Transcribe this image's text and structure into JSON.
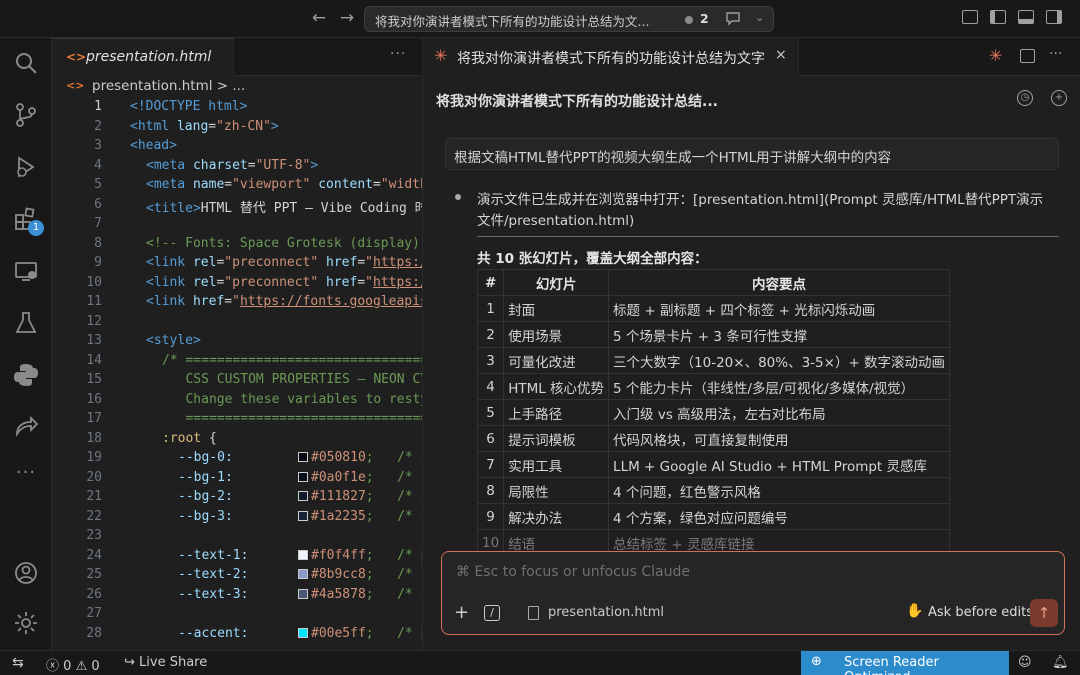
{
  "titlebar": {
    "command_center_title": "将我对你演讲者模式下所有的功能设计总结为文...",
    "notification_count": "2"
  },
  "activity_bar": {
    "extensions_badge": "1"
  },
  "editor": {
    "tab_title": "presentation.html",
    "breadcrumb": "presentation.html > ...",
    "icon_glyph": "<>",
    "more": "···"
  },
  "code_lines": [
    {
      "n": "1"
    },
    {
      "n": "2"
    },
    {
      "n": "3"
    },
    {
      "n": "4"
    },
    {
      "n": "5"
    },
    {
      "n": "6"
    },
    {
      "n": "7"
    },
    {
      "n": "8"
    },
    {
      "n": "9"
    },
    {
      "n": "10"
    },
    {
      "n": "11"
    },
    {
      "n": "12"
    },
    {
      "n": "13"
    },
    {
      "n": "14"
    },
    {
      "n": "15"
    },
    {
      "n": "16"
    },
    {
      "n": "17"
    },
    {
      "n": "18"
    },
    {
      "n": "19"
    },
    {
      "n": "20"
    },
    {
      "n": "21"
    },
    {
      "n": "22"
    },
    {
      "n": "23"
    },
    {
      "n": "24"
    },
    {
      "n": "25"
    },
    {
      "n": "26"
    },
    {
      "n": "27"
    },
    {
      "n": "28"
    }
  ],
  "code": {
    "l1": "<!DOCTYPE html>",
    "l2a": "<html ",
    "l2b": "lang",
    "l2c": "=",
    "l2d": "\"zh-CN\"",
    "l2e": ">",
    "l3": "<head>",
    "l4a": "<meta ",
    "l4b": "charset",
    "l4c": "=",
    "l4d": "\"UTF-8\"",
    "l4e": ">",
    "l5a": "<meta ",
    "l5b": "name",
    "l5c": "=",
    "l5d": "\"viewport\"",
    "l5e": " content",
    "l5f": "=",
    "l5g": "\"width",
    "l6a": "<title>",
    "l6b": "HTML 替代 PPT — Vibe Coding 时",
    "l8": "<!-- Fonts: Space Grotesk (display)",
    "l9a": "<link ",
    "l9b": "rel",
    "l9c": "=",
    "l9d": "\"preconnect\"",
    "l9e": " href",
    "l9f": "=",
    "l9g": "\"",
    "l9h": "https:/",
    "l10a": "<link ",
    "l10b": "rel",
    "l10c": "=",
    "l10d": "\"preconnect\"",
    "l10e": " href",
    "l10f": "=",
    "l10g": "\"",
    "l10h": "https:/",
    "l11a": "<link ",
    "l11b": "href",
    "l11c": "=",
    "l11d": "\"",
    "l11e": "https://fonts.googleapis",
    "l13": "<style>",
    "l14": "/* ================================",
    "l15": "   CSS CUSTOM PROPERTIES — NEON CY",
    "l16": "   Change these variables to resty",
    "l17": "   ================================",
    "l18a": ":root",
    "l18b": " {",
    "l19a": "--bg-0:",
    "l19b": "#050810",
    "l19c": ";   /* c",
    "l20a": "--bg-1:",
    "l20b": "#0a0f1e",
    "l20c": ";   /* s",
    "l21a": "--bg-2:",
    "l21b": "#111827",
    "l21c": ";   /* c",
    "l22a": "--bg-3:",
    "l22b": "#1a2235",
    "l22c": ";   /* c",
    "l24a": "--text-1:",
    "l24b": "#f0f4ff",
    "l24c": ";   /* p",
    "l25a": "--text-2:",
    "l25b": "#8b9cc8",
    "l25c": ";   /* s",
    "l26a": "--text-3:",
    "l26b": "#4a5878",
    "l26c": ";   /* c",
    "l28a": "--accent:",
    "l28b": "#00e5ff",
    "l28c": ";   /* p"
  },
  "swatch_colors": {
    "bg0": "#050810",
    "bg1": "#0a0f1e",
    "bg2": "#111827",
    "bg3": "#1a2235",
    "text1": "#f0f4ff",
    "text2": "#8b9cc8",
    "text3": "#4a5878",
    "accent": "#00e5ff"
  },
  "panel": {
    "tab_title": "将我对你演讲者模式下所有的功能设计总结为文字",
    "close": "×",
    "conversation_title": "将我对你演讲者模式下所有的功能设计总结...",
    "user_message": "根据文稿HTML替代PPT的视频大纲生成一个HTML用于讲解大纲中的内容",
    "reply_line1": "演示文件已生成并在浏览器中打开：[presentation.html](Prompt 灵感库/HTML替代PPT演示",
    "reply_line2": "文件/presentation.html)",
    "summary": "共 10 张幻灯片，覆盖大纲全部内容：",
    "table_headers": [
      "#",
      "幻灯片",
      "内容要点"
    ],
    "slides": [
      {
        "num": "1",
        "title": "封面",
        "points": "标题 + 副标题 + 四个标签 + 光标闪烁动画"
      },
      {
        "num": "2",
        "title": "使用场景",
        "points": "5 个场景卡片 + 3 条可行性支撑"
      },
      {
        "num": "3",
        "title": "可量化改进",
        "points": "三个大数字（10-20×、80%、3-5×）+ 数字滚动动画"
      },
      {
        "num": "4",
        "title": "HTML 核心优势",
        "points": "5 个能力卡片（非线性/多层/可视化/多媒体/视觉）"
      },
      {
        "num": "5",
        "title": "上手路径",
        "points": "入门级 vs 高级用法，左右对比布局"
      },
      {
        "num": "6",
        "title": "提示词模板",
        "points": "代码风格块，可直接复制使用"
      },
      {
        "num": "7",
        "title": "实用工具",
        "points": "LLM + Google AI Studio + HTML Prompt 灵感库"
      },
      {
        "num": "8",
        "title": "局限性",
        "points": "4 个问题，红色警示风格"
      },
      {
        "num": "9",
        "title": "解决办法",
        "points": "4 个方案，绿色对应问题编号"
      },
      {
        "num": "10",
        "title": "结语",
        "points": "总结标签 + 灵感库链接"
      }
    ],
    "input_placeholder": "⌘ Esc to focus or unfocus Claude",
    "attached_file": "presentation.html",
    "mode_label": "Ask before edits"
  },
  "statusbar": {
    "errors": "0",
    "warnings": "0",
    "live_share": "Live Share",
    "screen_reader": "Screen Reader Optimized"
  },
  "colors": {
    "accent_orange": "#e8765a",
    "status_blue": "#2c8bcb",
    "badge_blue": "#3d8fd6"
  }
}
